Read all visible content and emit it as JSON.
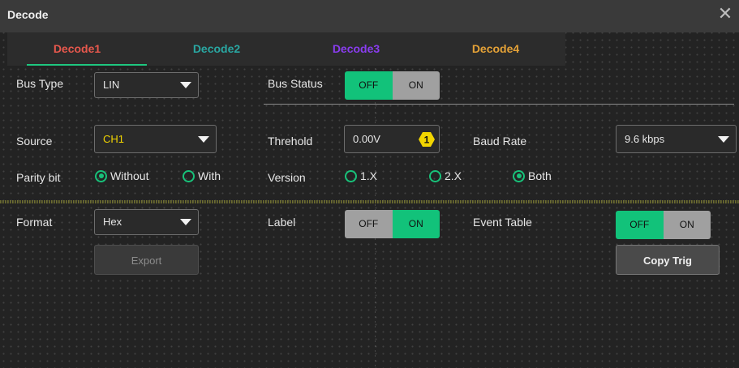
{
  "title": "Decode",
  "tabs": [
    "Decode1",
    "Decode2",
    "Decode3",
    "Decode4"
  ],
  "bus_type": {
    "label": "Bus Type",
    "value": "LIN"
  },
  "bus_status": {
    "label": "Bus Status",
    "off": "OFF",
    "on": "ON",
    "selected": "OFF"
  },
  "source": {
    "label": "Source",
    "value": "CH1"
  },
  "threshold": {
    "label": "Threhold",
    "value": "0.00V",
    "badge": "1"
  },
  "baud_rate": {
    "label": "Baud Rate",
    "value": "9.6 kbps"
  },
  "parity": {
    "label": "Parity bit",
    "options": [
      "Without",
      "With"
    ],
    "selected": "Without"
  },
  "version": {
    "label": "Version",
    "options": [
      "1.X",
      "2.X",
      "Both"
    ],
    "selected": "Both"
  },
  "format": {
    "label": "Format",
    "value": "Hex"
  },
  "label_toggle": {
    "label": "Label",
    "off": "OFF",
    "on": "ON",
    "selected": "ON"
  },
  "event_table": {
    "label": "Event Table",
    "off": "OFF",
    "on": "ON",
    "selected": "OFF"
  },
  "buttons": {
    "export": "Export",
    "copy_trig": "Copy Trig"
  },
  "colors": {
    "accent_green": "#12c27a",
    "tab1": "#e8584d",
    "tab2": "#29a7a2",
    "tab3": "#8a3df0",
    "tab4": "#e5a237",
    "source_ch1": "#f2d500"
  }
}
